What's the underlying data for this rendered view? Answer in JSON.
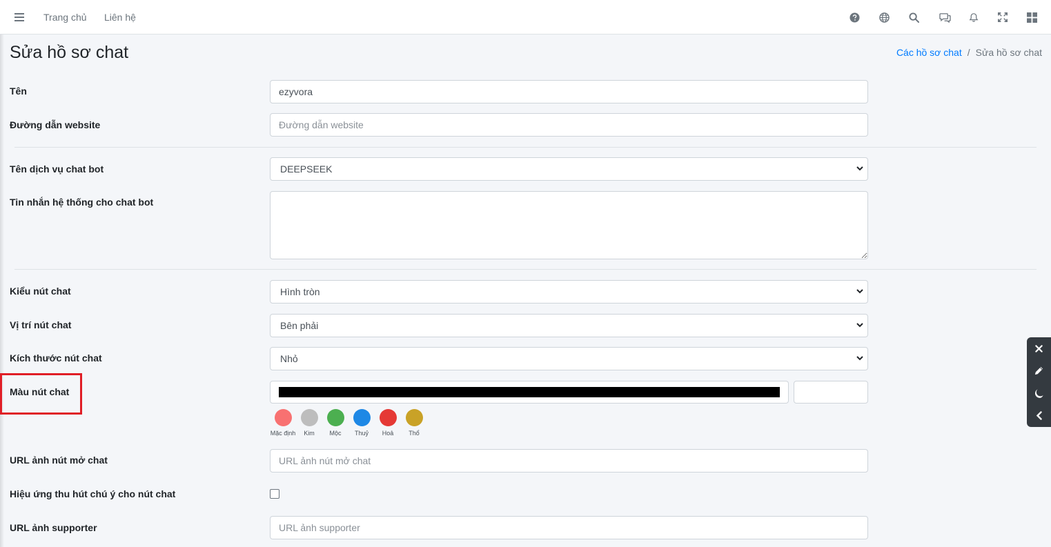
{
  "navbar": {
    "links": {
      "home": "Trang chủ",
      "contact": "Liên hệ"
    },
    "icons": [
      "menu-icon",
      "help-icon",
      "globe-icon",
      "search-icon",
      "chat-icon",
      "bell-icon",
      "fullscreen-icon",
      "apps-grid-icon"
    ]
  },
  "page": {
    "title": "Sửa hồ sơ chat",
    "breadcrumb": {
      "parent": "Các hồ sơ chat",
      "separator": "/",
      "current": "Sửa hồ sơ chat"
    }
  },
  "form": {
    "name": {
      "label": "Tên",
      "value": "ezyvora"
    },
    "website": {
      "label": "Đường dẫn website",
      "placeholder": "Đường dẫn website",
      "value": ""
    },
    "chatbot_service": {
      "label": "Tên dịch vụ chat bot",
      "value": "DEEPSEEK"
    },
    "system_message": {
      "label": "Tin nhắn hệ thống cho chat bot",
      "value": ""
    },
    "button_style": {
      "label": "Kiểu nút chat",
      "value": "Hình tròn"
    },
    "button_position": {
      "label": "Vị trí nút chat",
      "value": "Bên phải"
    },
    "button_size": {
      "label": "Kích thước nút chat",
      "value": "Nhỏ"
    },
    "button_color": {
      "label": "Màu nút chat",
      "value": "#000000",
      "text_value": "",
      "presets": [
        {
          "name": "Mặc định",
          "color": "#f87171"
        },
        {
          "name": "Kim",
          "color": "#bdbdbd"
        },
        {
          "name": "Mộc",
          "color": "#4caf50"
        },
        {
          "name": "Thuỷ",
          "color": "#1e88e5"
        },
        {
          "name": "Hoả",
          "color": "#e53935"
        },
        {
          "name": "Thổ",
          "color": "#c9a227"
        }
      ]
    },
    "open_button_image_url": {
      "label": "URL ảnh nút mở chat",
      "placeholder": "URL ảnh nút mở chat",
      "value": ""
    },
    "attention_effect": {
      "label": "Hiệu ứng thu hút chú ý cho nút chat",
      "checked": false
    },
    "supporter_image_url": {
      "label": "URL ảnh supporter",
      "placeholder": "URL ảnh supporter",
      "value": ""
    }
  },
  "side_panel": {
    "icons": [
      "close-icon",
      "pencil-icon",
      "moon-icon",
      "chevron-left-icon"
    ]
  },
  "colors": {
    "accent": "#007bff",
    "highlight": "#e01e26",
    "panel": "#343a40"
  }
}
